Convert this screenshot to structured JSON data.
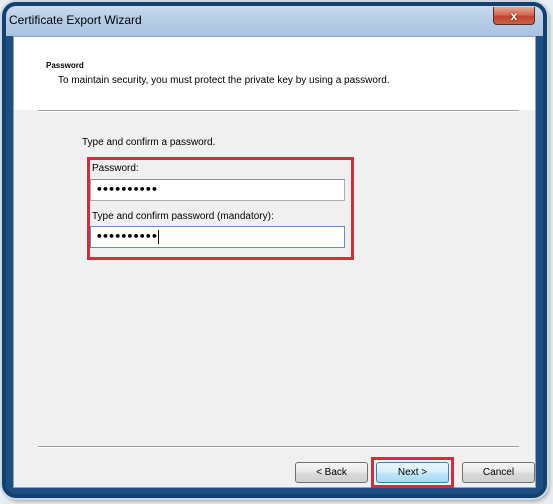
{
  "window": {
    "title": "Certificate Export Wizard",
    "close_label": "x"
  },
  "header": {
    "title": "Password",
    "description": "To maintain security, you must protect the private key by using a password."
  },
  "form": {
    "instruction": "Type and confirm a password.",
    "password_label": "Password:",
    "password_value": "••••••••••",
    "confirm_label": "Type and confirm password (mandatory):",
    "confirm_value": "••••••••••"
  },
  "buttons": {
    "back": "< Back",
    "next": "Next >",
    "cancel": "Cancel"
  },
  "colors": {
    "highlight": "#d52b3c",
    "frame": "#13406d"
  }
}
